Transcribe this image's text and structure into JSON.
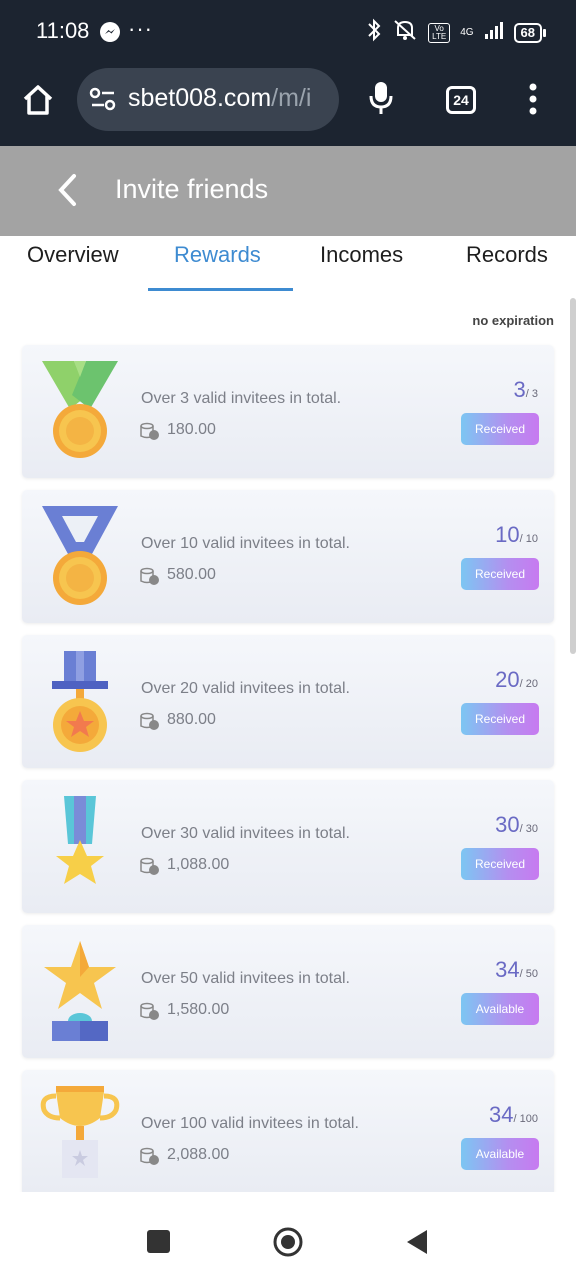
{
  "status_bar": {
    "time": "11:08",
    "more": "···",
    "network_type": "4G",
    "volte": "Vo LTE",
    "battery": "68"
  },
  "browser": {
    "url_domain": "sbet008.com",
    "url_path": "/m/i",
    "tab_count": "24"
  },
  "header": {
    "title": "Invite friends"
  },
  "tabs": [
    {
      "label": "Overview"
    },
    {
      "label": "Rewards"
    },
    {
      "label": "Incomes"
    },
    {
      "label": "Records"
    }
  ],
  "active_tab": "Rewards",
  "expiry_note": "no expiration",
  "colors": {
    "accent": "#3e8bd1",
    "progress": "#6a6ac4",
    "header_bg": "#a3a3a3",
    "browser_bg": "#1c2430"
  },
  "rewards": [
    {
      "desc": "Over 3 valid invitees in total.",
      "amount": "180.00",
      "current": "3",
      "total": "/ 3",
      "status": "Received",
      "icon": "green-ribbon-medal-icon"
    },
    {
      "desc": "Over 10 valid invitees in total.",
      "amount": "580.00",
      "current": "10",
      "total": "/ 10",
      "status": "Received",
      "icon": "blue-ribbon-medal-icon"
    },
    {
      "desc": "Over 20 valid invitees in total.",
      "amount": "880.00",
      "current": "20",
      "total": "/ 20",
      "status": "Received",
      "icon": "star-medal-icon"
    },
    {
      "desc": "Over 30 valid invitees in total.",
      "amount": "1,088.00",
      "current": "30",
      "total": "/ 30",
      "status": "Received",
      "icon": "star-ribbon-medal-icon"
    },
    {
      "desc": "Over 50 valid invitees in total.",
      "amount": "1,580.00",
      "current": "34",
      "total": "/ 50",
      "status": "Available",
      "icon": "star-trophy-icon"
    },
    {
      "desc": "Over 100 valid invitees in total.",
      "amount": "2,088.00",
      "current": "34",
      "total": "/ 100",
      "status": "Available",
      "icon": "gold-cup-trophy-icon"
    }
  ]
}
